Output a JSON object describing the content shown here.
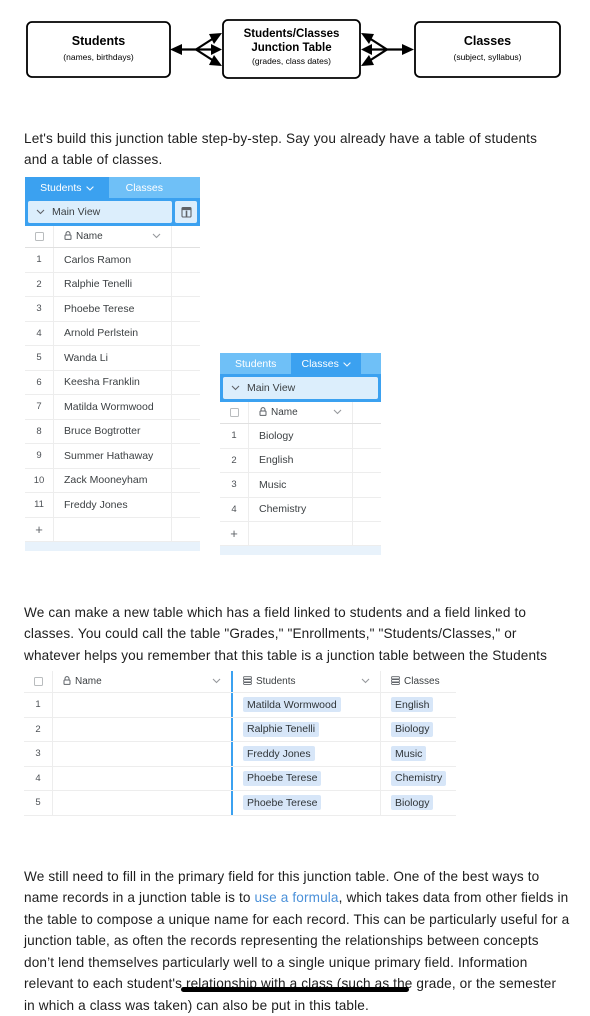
{
  "diagram": {
    "boxes": [
      {
        "title": "Students",
        "subtitle": "(names, birthdays)"
      },
      {
        "title_line1": "Students/Classes",
        "title_line2": "Junction Table",
        "subtitle": "(grades, class dates)"
      },
      {
        "title": "Classes",
        "subtitle": "(subject, syllabus)"
      }
    ]
  },
  "paragraphs": {
    "p1": "Let's build this junction table step-by-step. Say you already have a table of students and a table of classes.",
    "p2": "We can make a new table which has a field linked to students and a field linked to classes. You could call the table \"Grades,\" \"Enrollments,\" \"Students/Classes,\" or whatever helps you remember that this table is a junction table between the Students and Classes tables.",
    "p3_part1": "We still need to fill in the primary field for this junction table. One of the best ways to name records in a junction table is to ",
    "p3_link": "use a formula",
    "p3_part2": ", which takes data from other fields in the table to compose a unique name for each record. This can be particularly useful for a junction table, as often the records representing the relationships between concepts don’t lend themselves particularly well to a single unique primary field. Information relevant to each student's relationship with a class (such as the grade, or the semester in which a class was taken) can also be put in this table."
  },
  "students_table": {
    "tabs": [
      {
        "label": "Students",
        "active": true,
        "has_caret": true
      },
      {
        "label": "Classes",
        "active": false,
        "has_caret": false
      }
    ],
    "view_name": "Main View",
    "view_button_icon": "calendar-icon",
    "columns": [
      {
        "label": "Name",
        "icon": "lock-icon",
        "caret": true
      }
    ],
    "rows": [
      {
        "num": "1",
        "name": "Carlos Ramon"
      },
      {
        "num": "2",
        "name": "Ralphie Tenelli"
      },
      {
        "num": "3",
        "name": "Phoebe Terese"
      },
      {
        "num": "4",
        "name": "Arnold Perlstein"
      },
      {
        "num": "5",
        "name": "Wanda Li"
      },
      {
        "num": "6",
        "name": "Keesha Franklin"
      },
      {
        "num": "7",
        "name": "Matilda Wormwood"
      },
      {
        "num": "8",
        "name": "Bruce Bogtrotter"
      },
      {
        "num": "9",
        "name": "Summer Hathaway"
      },
      {
        "num": "10",
        "name": "Zack Mooneyham"
      },
      {
        "num": "11",
        "name": "Freddy Jones"
      }
    ],
    "add_row_label": "+"
  },
  "classes_table": {
    "tabs": [
      {
        "label": "Students",
        "active": false,
        "has_caret": false
      },
      {
        "label": "Classes",
        "active": true,
        "has_caret": true
      }
    ],
    "view_name": "Main View",
    "columns": [
      {
        "label": "Name",
        "icon": "lock-icon",
        "caret": true
      }
    ],
    "rows": [
      {
        "num": "1",
        "name": "Biology"
      },
      {
        "num": "2",
        "name": "English"
      },
      {
        "num": "3",
        "name": "Music"
      },
      {
        "num": "4",
        "name": "Chemistry"
      }
    ],
    "add_row_label": "+"
  },
  "junction_table": {
    "columns": [
      {
        "label": "Name",
        "icon": "lock-icon",
        "caret": true
      },
      {
        "label": "Students",
        "icon": "link-field-icon",
        "caret": true
      },
      {
        "label": "Classes",
        "icon": "link-field-icon",
        "caret": false
      }
    ],
    "rows": [
      {
        "num": "1",
        "name": "",
        "students": "Matilda Wormwood",
        "classes": "English"
      },
      {
        "num": "2",
        "name": "",
        "students": "Ralphie Tenelli",
        "classes": "Biology"
      },
      {
        "num": "3",
        "name": "",
        "students": "Freddy Jones",
        "classes": "Music"
      },
      {
        "num": "4",
        "name": "",
        "students": "Phoebe Terese",
        "classes": "Chemistry"
      },
      {
        "num": "5",
        "name": "",
        "students": "Phoebe Terese",
        "classes": "Biology"
      }
    ]
  },
  "colors": {
    "accent_blue": "#3ba1f0",
    "tab_inactive_blue": "#6fc0f7",
    "view_box_blue": "#dceefc",
    "chip_blue": "#d7e6f8",
    "link_text": "#4a90d9"
  }
}
